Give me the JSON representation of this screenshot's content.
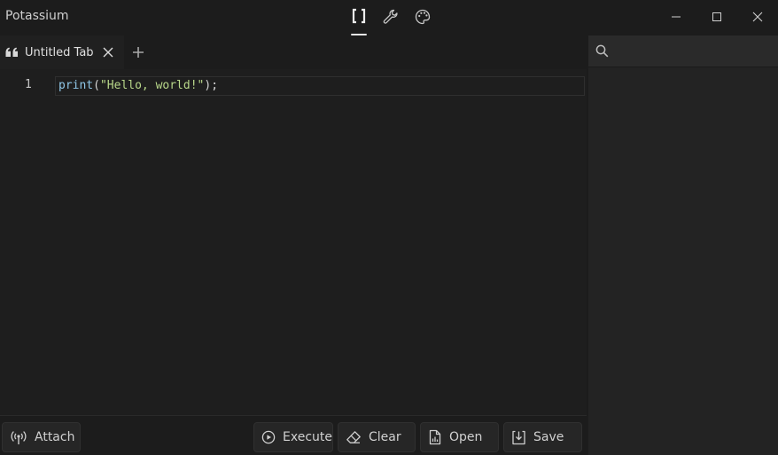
{
  "app": {
    "title": "Potassium"
  },
  "top_nav": [
    {
      "icon": "brackets-icon",
      "active": true
    },
    {
      "icon": "wrench-icon",
      "active": false
    },
    {
      "icon": "palette-icon",
      "active": false
    }
  ],
  "window_controls": [
    "minimize-icon",
    "maximize-icon",
    "close-icon"
  ],
  "tabs": [
    {
      "label": "Untitled Tab",
      "icon": "quote-icon"
    }
  ],
  "editor": {
    "line_numbers": [
      "1"
    ],
    "code": {
      "fn": "print",
      "open": "(",
      "string": "\"Hello, world!\"",
      "close": ");"
    }
  },
  "search": {
    "placeholder": ""
  },
  "bottom_bar": {
    "attach_label": "Attach",
    "execute_label": "Execute",
    "clear_label": "Clear",
    "open_label": "Open",
    "save_label": "Save"
  },
  "colors": {
    "background": "#1c1c1c",
    "editor_background": "#1e1e1e",
    "panel_background": "#232323",
    "syntax_function": "#8fc7e8",
    "syntax_string": "#b9d88a"
  }
}
